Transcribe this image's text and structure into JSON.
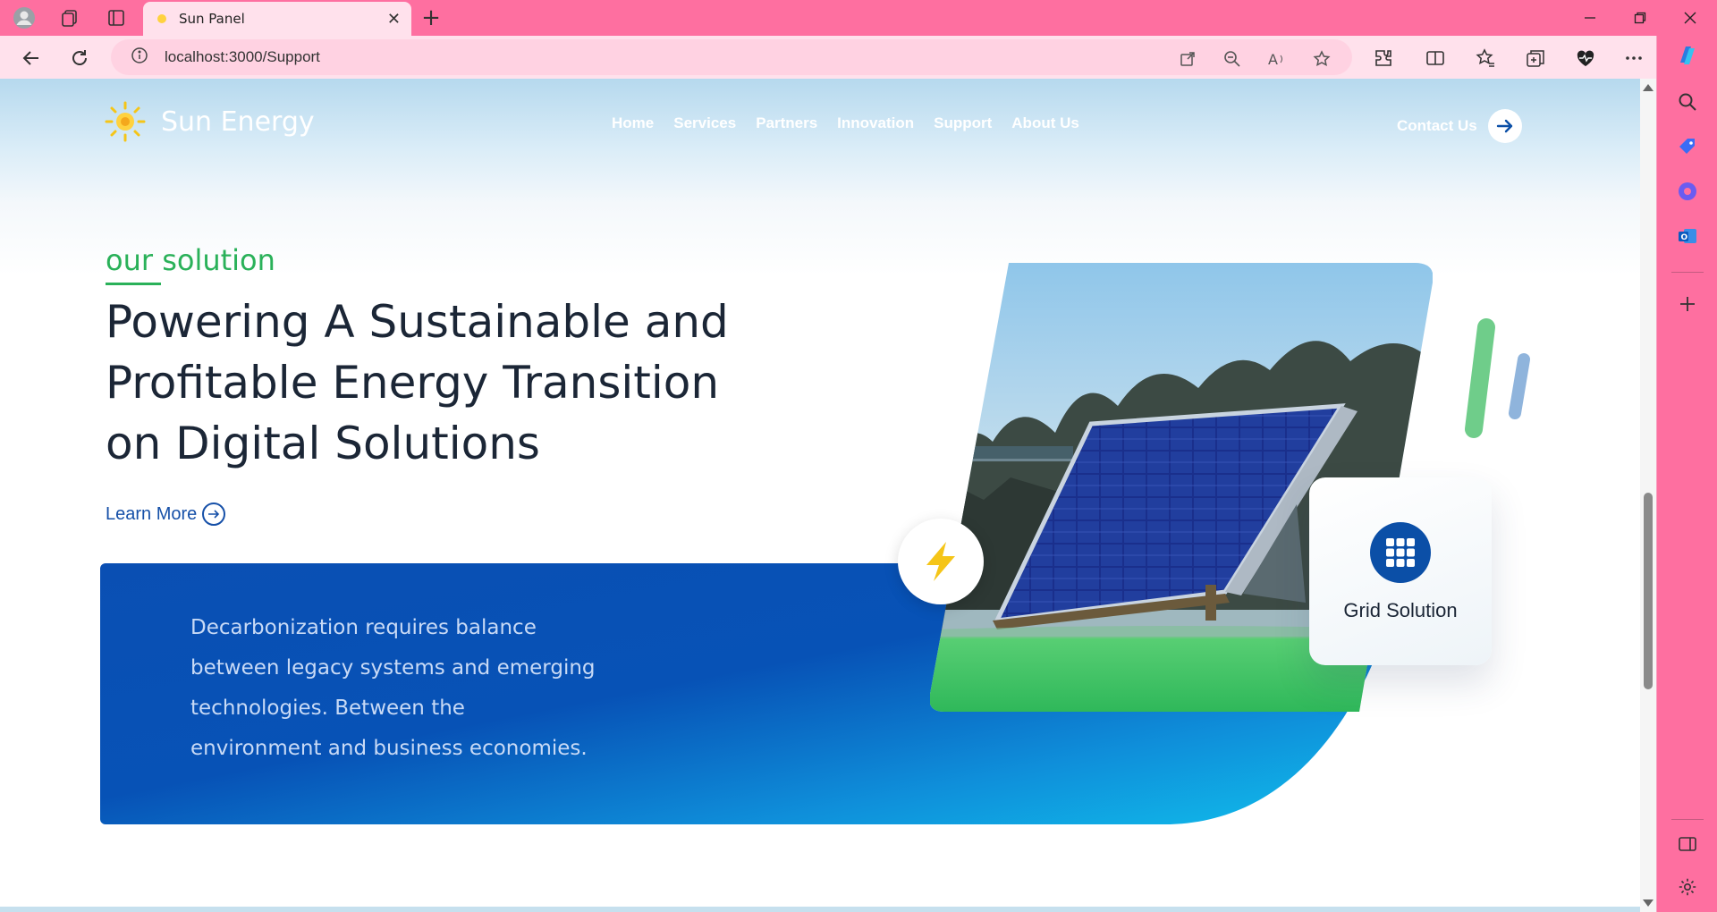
{
  "browser": {
    "tab_title": "Sun Panel",
    "url": "localhost:3000/Support"
  },
  "site": {
    "brand": "Sun Energy",
    "nav": [
      "Home",
      "Services",
      "Partners",
      "Innovation",
      "Support",
      "About Us"
    ],
    "contact_label": "Contact Us"
  },
  "hero": {
    "eyebrow": "our solution",
    "headline": "Powering A Sustainable and Profitable Energy Transition on Digital Solutions",
    "learn_more": "Learn More",
    "band_text": "Decarbonization requires balance between legacy systems and emerging technologies. Between the environment and business economies.",
    "card_label": "Grid Solution"
  },
  "colors": {
    "accent_green": "#2ab159",
    "brand_blue": "#0b4fa7",
    "browser_pink": "#fe6fa0"
  }
}
